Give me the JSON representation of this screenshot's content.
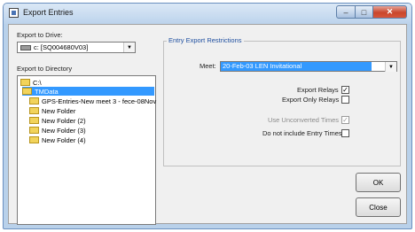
{
  "window": {
    "title": "Export Entries"
  },
  "export_to_drive": {
    "label": "Export to Drive:",
    "selected_value": "c: [SQ004680V03]"
  },
  "export_to_directory": {
    "label": "Export to Directory",
    "items": [
      {
        "label": "C:\\",
        "selected": false
      },
      {
        "label": "TMData",
        "selected": true
      },
      {
        "label": "GPS-Entries-New meet 3 - fece-08Nov",
        "selected": false
      },
      {
        "label": "New Folder",
        "selected": false
      },
      {
        "label": "New Folder (2)",
        "selected": false
      },
      {
        "label": "New Folder (3)",
        "selected": false
      },
      {
        "label": "New Folder (4)",
        "selected": false
      }
    ]
  },
  "restrictions": {
    "title": "Entry Export Restrictions",
    "meet_label": "Meet:",
    "meet_value": "20-Feb-03 LEN Invitational",
    "export_relays_label": "Export Relays",
    "export_relays_checked": true,
    "export_only_relays_label": "Export Only Relays",
    "export_only_relays_checked": false,
    "use_unconverted_times_label": "Use Unconverted Times",
    "use_unconverted_times_checked": true,
    "do_not_include_entry_times_label": "Do not include Entry Times",
    "do_not_include_entry_times_checked": false
  },
  "buttons": {
    "ok": "OK",
    "close": "Close"
  },
  "glyphs": {
    "check": "✓",
    "dropdown": "▼",
    "close": "✕",
    "minimize": "–",
    "maximize": "□"
  }
}
